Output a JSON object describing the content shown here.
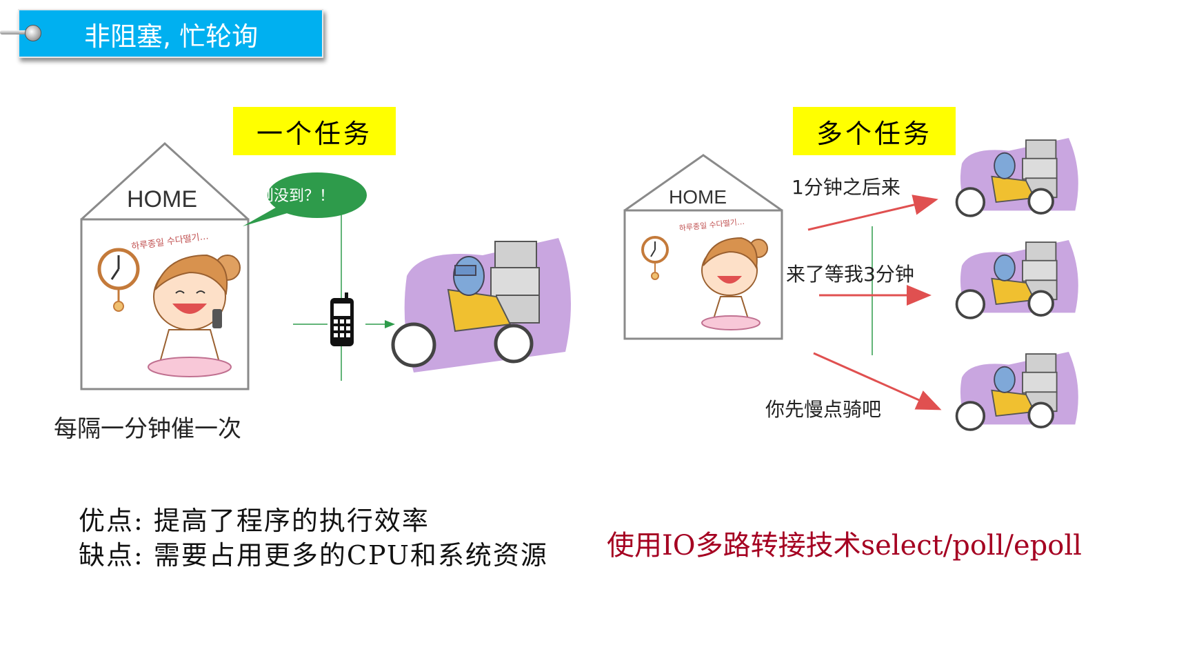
{
  "title": "非阻塞, 忙轮询",
  "left": {
    "label": "一个任务",
    "home": "HOME",
    "bubble": "到没到？！",
    "caption": "每隔一分钟催一次"
  },
  "right": {
    "label": "多个任务",
    "home": "HOME",
    "messages": [
      "1分钟之后来",
      "来了等我3分钟",
      "你先慢点骑吧"
    ]
  },
  "notes": {
    "pros": "优点: 提高了程序的执行效率",
    "cons": "缺点: 需要占用更多的CPU和系统资源"
  },
  "technique": "使用IO多路转接技术select/poll/epoll",
  "colors": {
    "title_bg": "#00b0f0",
    "label_bg": "#ffff00",
    "bubble": "#2e9b4b",
    "arrow": "#e05050",
    "technique": "#a50021",
    "courier_bg": "#c9a6e0"
  }
}
